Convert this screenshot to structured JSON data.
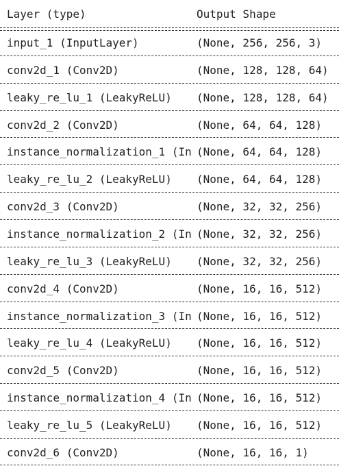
{
  "header": {
    "layer_col": "Layer (type)",
    "shape_col": "Output Shape"
  },
  "rows": [
    {
      "layer": "input_1 (InputLayer)",
      "shape": "(None, 256, 256, 3)"
    },
    {
      "layer": "conv2d_1 (Conv2D)",
      "shape": "(None, 128, 128, 64)"
    },
    {
      "layer": "leaky_re_lu_1 (LeakyReLU)",
      "shape": "(None, 128, 128, 64)"
    },
    {
      "layer": "conv2d_2 (Conv2D)",
      "shape": "(None, 64, 64, 128)"
    },
    {
      "layer": "instance_normalization_1 (In",
      "shape": "(None, 64, 64, 128)"
    },
    {
      "layer": "leaky_re_lu_2 (LeakyReLU)",
      "shape": "(None, 64, 64, 128)"
    },
    {
      "layer": "conv2d_3 (Conv2D)",
      "shape": "(None, 32, 32, 256)"
    },
    {
      "layer": "instance_normalization_2 (In",
      "shape": "(None, 32, 32, 256)"
    },
    {
      "layer": "leaky_re_lu_3 (LeakyReLU)",
      "shape": "(None, 32, 32, 256)"
    },
    {
      "layer": "conv2d_4 (Conv2D)",
      "shape": "(None, 16, 16, 512)"
    },
    {
      "layer": "instance_normalization_3 (In",
      "shape": "(None, 16, 16, 512)"
    },
    {
      "layer": "leaky_re_lu_4 (LeakyReLU)",
      "shape": "(None, 16, 16, 512)"
    },
    {
      "layer": "conv2d_5 (Conv2D)",
      "shape": "(None, 16, 16, 512)"
    },
    {
      "layer": "instance_normalization_4 (In",
      "shape": "(None, 16, 16, 512)"
    },
    {
      "layer": "leaky_re_lu_5 (LeakyReLU)",
      "shape": "(None, 16, 16, 512)"
    },
    {
      "layer": "conv2d_6 (Conv2D)",
      "shape": "(None, 16, 16, 1)"
    }
  ]
}
